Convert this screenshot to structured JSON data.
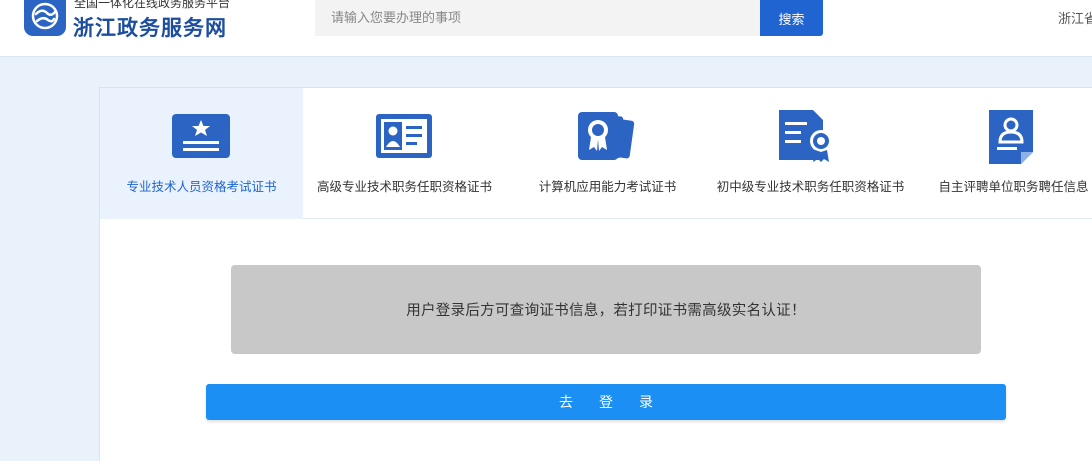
{
  "header": {
    "logo_subtitle": "全国一体化在线政务服务平台",
    "logo_title": "浙江政务服务网",
    "search_placeholder": "请输入您要办理的事项",
    "search_button": "搜索",
    "region_link": "浙江省"
  },
  "tabs": [
    {
      "label": "专业技术人员资格考试证书",
      "icon": "certificate-star-icon",
      "active": true
    },
    {
      "label": "高级专业技术职务任职资格证书",
      "icon": "id-card-icon",
      "active": false
    },
    {
      "label": "计算机应用能力考试证书",
      "icon": "medal-cards-icon",
      "active": false
    },
    {
      "label": "初中级专业技术职务任职资格证书",
      "icon": "document-badge-icon",
      "active": false
    },
    {
      "label": "自主评聘单位职务聘任信息",
      "icon": "person-document-icon",
      "active": false
    }
  ],
  "notice": {
    "text": "用户登录后方可查询证书信息，若打印证书需高级实名认证！"
  },
  "login_button": "去登录",
  "colors": {
    "brand_blue": "#1f64d1",
    "icon_blue": "#2b64c3",
    "login_blue": "#1b8ff3",
    "page_bg": "#e9f2fb",
    "notice_bg": "#c8c8c8"
  }
}
